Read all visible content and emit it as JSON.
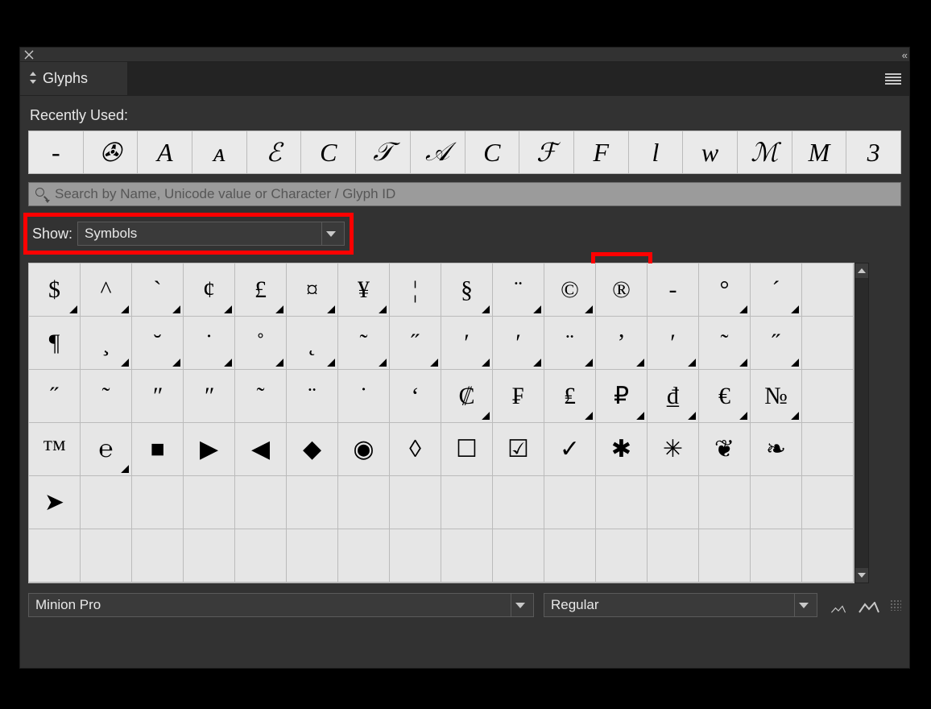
{
  "panel": {
    "title": "Glyphs",
    "recently_used_label": "Recently Used:",
    "search": {
      "placeholder": "Search by Name, Unicode value or Character / Glyph ID"
    },
    "show_label": "Show:",
    "show_value": "Symbols",
    "font_family": "Minion Pro",
    "font_style": "Regular"
  },
  "recently_used": [
    "-",
    "✇",
    "A",
    "ᴀ",
    "ℰ",
    "C",
    "𝒯",
    "𝒜",
    "C",
    "ℱ",
    "F",
    "l",
    "w",
    "ℳ",
    "M",
    "3"
  ],
  "grid_rows": [
    [
      {
        "g": "$",
        "a": 1
      },
      {
        "g": "^",
        "a": 1
      },
      {
        "g": "`",
        "a": 1
      },
      {
        "g": "¢",
        "a": 1
      },
      {
        "g": "£",
        "a": 1
      },
      {
        "g": "¤",
        "a": 1
      },
      {
        "g": "¥",
        "a": 1
      },
      {
        "g": "¦",
        "a": 0
      },
      {
        "g": "§",
        "a": 1
      },
      {
        "g": "¨",
        "a": 1
      },
      {
        "g": "©",
        "a": 1
      },
      {
        "g": "®",
        "a": 0
      },
      {
        "g": "-",
        "a": 0
      },
      {
        "g": "°",
        "a": 1
      },
      {
        "g": "´",
        "a": 1
      },
      {
        "g": "",
        "a": 0
      }
    ],
    [
      {
        "g": "¶",
        "a": 0
      },
      {
        "g": "¸",
        "a": 1
      },
      {
        "g": "˘",
        "a": 1
      },
      {
        "g": "˙",
        "a": 1
      },
      {
        "g": "˚",
        "a": 1
      },
      {
        "g": "˛",
        "a": 1
      },
      {
        "g": "˜",
        "a": 1
      },
      {
        "g": "˝",
        "a": 1
      },
      {
        "g": "ʹ",
        "a": 1
      },
      {
        "g": "ʹ",
        "a": 1
      },
      {
        "g": "¨",
        "a": 1
      },
      {
        "g": "ʼ",
        "a": 1
      },
      {
        "g": "ʹ",
        "a": 1
      },
      {
        "g": "˜",
        "a": 1
      },
      {
        "g": "˝",
        "a": 1
      },
      {
        "g": "",
        "a": 0
      }
    ],
    [
      {
        "g": "˝",
        "a": 0
      },
      {
        "g": "˜",
        "a": 0
      },
      {
        "g": "ʺ",
        "a": 0
      },
      {
        "g": "ʺ",
        "a": 0
      },
      {
        "g": "˜",
        "a": 0
      },
      {
        "g": "¨",
        "a": 0
      },
      {
        "g": "˙",
        "a": 0
      },
      {
        "g": "ʻ",
        "a": 0
      },
      {
        "g": "₡",
        "a": 1
      },
      {
        "g": "₣",
        "a": 0
      },
      {
        "g": "₤",
        "a": 1
      },
      {
        "g": "₽",
        "a": 1
      },
      {
        "g": "₫",
        "a": 1
      },
      {
        "g": "€",
        "a": 1
      },
      {
        "g": "№",
        "a": 1
      },
      {
        "g": "",
        "a": 0
      }
    ],
    [
      {
        "g": "™",
        "a": 0
      },
      {
        "g": "℮",
        "a": 1
      },
      {
        "g": "■",
        "a": 0
      },
      {
        "g": "▶",
        "a": 0
      },
      {
        "g": "◀",
        "a": 0
      },
      {
        "g": "◆",
        "a": 0
      },
      {
        "g": "◉",
        "a": 0
      },
      {
        "g": "◊",
        "a": 0
      },
      {
        "g": "☐",
        "a": 0
      },
      {
        "g": "☑",
        "a": 0
      },
      {
        "g": "✓",
        "a": 0
      },
      {
        "g": "✱",
        "a": 0
      },
      {
        "g": "✳",
        "a": 0
      },
      {
        "g": "❦",
        "a": 0
      },
      {
        "g": "❧",
        "a": 0
      },
      {
        "g": "",
        "a": 0
      }
    ],
    [
      {
        "g": "➤",
        "a": 0
      },
      {
        "g": "",
        "a": 0
      },
      {
        "g": "",
        "a": 0
      },
      {
        "g": "",
        "a": 0
      },
      {
        "g": "",
        "a": 0
      },
      {
        "g": "",
        "a": 0
      },
      {
        "g": "",
        "a": 0
      },
      {
        "g": "",
        "a": 0
      },
      {
        "g": "",
        "a": 0
      },
      {
        "g": "",
        "a": 0
      },
      {
        "g": "",
        "a": 0
      },
      {
        "g": "",
        "a": 0
      },
      {
        "g": "",
        "a": 0
      },
      {
        "g": "",
        "a": 0
      },
      {
        "g": "",
        "a": 0
      },
      {
        "g": "",
        "a": 0
      }
    ],
    [
      {
        "g": "",
        "a": 0
      },
      {
        "g": "",
        "a": 0
      },
      {
        "g": "",
        "a": 0
      },
      {
        "g": "",
        "a": 0
      },
      {
        "g": "",
        "a": 0
      },
      {
        "g": "",
        "a": 0
      },
      {
        "g": "",
        "a": 0
      },
      {
        "g": "",
        "a": 0
      },
      {
        "g": "",
        "a": 0
      },
      {
        "g": "",
        "a": 0
      },
      {
        "g": "",
        "a": 0
      },
      {
        "g": "",
        "a": 0
      },
      {
        "g": "",
        "a": 0
      },
      {
        "g": "",
        "a": 0
      },
      {
        "g": "",
        "a": 0
      },
      {
        "g": "",
        "a": 0
      }
    ]
  ],
  "highlights": {
    "glyph_cell": {
      "row": 0,
      "col": 11
    }
  }
}
